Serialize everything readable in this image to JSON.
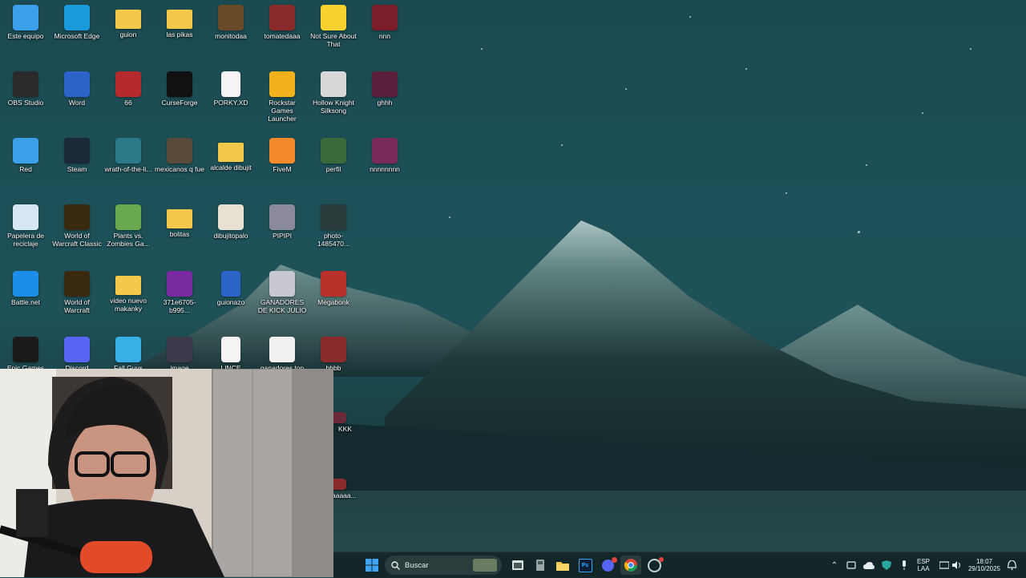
{
  "desktop": {
    "icons": [
      {
        "label": "Este equipo",
        "icon": "monitor-icon",
        "color": "#3aa0e8"
      },
      {
        "label": "Microsoft Edge",
        "icon": "edge-icon",
        "color": "#1b9ad9"
      },
      {
        "label": "guion",
        "icon": "folder-icon",
        "color": "#f3c94b"
      },
      {
        "label": "las pikas",
        "icon": "folder-icon",
        "color": "#f3c94b"
      },
      {
        "label": "monitodaa",
        "icon": "image-thumbnail-icon",
        "color": "#6b4a2a"
      },
      {
        "label": "tomatedaaa",
        "icon": "image-thumbnail-icon",
        "color": "#8a2a2a"
      },
      {
        "label": "Not Sure About That",
        "icon": "rubber-duck-icon",
        "color": "#f5d230"
      },
      {
        "label": "nnn",
        "icon": "video-thumbnail-icon",
        "color": "#7a1f2a"
      },
      {
        "label": "OBS Studio",
        "icon": "obs-icon",
        "color": "#2b2b2b"
      },
      {
        "label": "Word",
        "icon": "word-icon",
        "color": "#2b63c7"
      },
      {
        "label": "66",
        "icon": "image-thumbnail-icon",
        "color": "#b52a2a"
      },
      {
        "label": "CurseForge",
        "icon": "curseforge-icon",
        "color": "#111111"
      },
      {
        "label": "PORKY.XD",
        "icon": "video-file-icon",
        "color": "#f4f4f4"
      },
      {
        "label": "Rockstar Games Launcher",
        "icon": "rockstar-icon",
        "color": "#f2b21c"
      },
      {
        "label": "Hollow Knight Silksong",
        "icon": "hollow-knight-icon",
        "color": "#d8d8d8"
      },
      {
        "label": "ghhh",
        "icon": "video-thumbnail-icon",
        "color": "#5a1f3a"
      },
      {
        "label": "Red",
        "icon": "network-icon",
        "color": "#3aa0e8"
      },
      {
        "label": "Steam",
        "icon": "steam-icon",
        "color": "#1b2838"
      },
      {
        "label": "wrath-of-the-li...",
        "icon": "image-thumbnail-icon",
        "color": "#2a7a8a"
      },
      {
        "label": "mexicanos q fue",
        "icon": "image-thumbnail-icon",
        "color": "#5a4a3a"
      },
      {
        "label": "alcalde dibujit",
        "icon": "folder-icon",
        "color": "#f3c94b"
      },
      {
        "label": "FiveM",
        "icon": "fivem-icon",
        "color": "#f28a2a"
      },
      {
        "label": "perfil",
        "icon": "image-thumbnail-icon",
        "color": "#3a6a3a"
      },
      {
        "label": "nnnnnnnn",
        "icon": "video-thumbnail-icon",
        "color": "#7a2a5a"
      },
      {
        "label": "Papelera de reciclaje",
        "icon": "recycle-bin-icon",
        "color": "#d6e6f2"
      },
      {
        "label": "World of Warcraft Classic",
        "icon": "wow-icon",
        "color": "#3a2a10"
      },
      {
        "label": "Plants vs. Zombies Ga...",
        "icon": "pvz-icon",
        "color": "#6aa84f"
      },
      {
        "label": "bolitas",
        "icon": "folder-icon",
        "color": "#f3c94b"
      },
      {
        "label": "dibujitopalo",
        "icon": "image-thumbnail-icon",
        "color": "#e8e0d0"
      },
      {
        "label": "PIPIPI",
        "icon": "image-thumbnail-icon",
        "color": "#8a8a9a"
      },
      {
        "label": "photo-1485470...",
        "icon": "image-thumbnail-icon",
        "color": "#2a3a3a"
      },
      {
        "label": "",
        "icon": "",
        "color": ""
      },
      {
        "label": "Battle.net",
        "icon": "battlenet-icon",
        "color": "#1c8ee8"
      },
      {
        "label": "World of Warcraft",
        "icon": "wow-icon",
        "color": "#3a2a10"
      },
      {
        "label": "video nuevo makanky",
        "icon": "folder-icon",
        "color": "#f3c94b"
      },
      {
        "label": "371e6705-b995...",
        "icon": "image-thumbnail-icon",
        "color": "#7a2aa0"
      },
      {
        "label": "guionazo",
        "icon": "word-doc-icon",
        "color": "#2b63c7"
      },
      {
        "label": "GANADORES DE KICK JULIO",
        "icon": "image-thumbnail-icon",
        "color": "#c8c8d0"
      },
      {
        "label": "Megabonk",
        "icon": "megabonk-icon",
        "color": "#b8302a"
      },
      {
        "label": "",
        "icon": "",
        "color": ""
      },
      {
        "label": "Epic Games",
        "icon": "epic-games-icon",
        "color": "#1a1a1a"
      },
      {
        "label": "Discord",
        "icon": "discord-icon",
        "color": "#5865f2"
      },
      {
        "label": "Fall Guys",
        "icon": "fall-guys-icon",
        "color": "#3ab0e8"
      },
      {
        "label": "image",
        "icon": "image-thumbnail-icon",
        "color": "#3a3a4a"
      },
      {
        "label": "LINCE",
        "icon": "video-file-icon",
        "color": "#f4f4f4"
      },
      {
        "label": "ganadores top",
        "icon": "image-thumbnail-icon",
        "color": "#f0f0f0"
      },
      {
        "label": "bbbb",
        "icon": "video-thumbnail-icon",
        "color": "#8a2a2a"
      },
      {
        "label": "",
        "icon": "",
        "color": ""
      }
    ],
    "partial_icons": [
      {
        "label": "KKK",
        "icon": "video-thumbnail-icon"
      },
      {
        "label": "aaaaa...",
        "icon": "video-thumbnail-icon"
      }
    ]
  },
  "taskbar": {
    "search_placeholder": "Buscar",
    "apps": [
      "start-icon",
      "task-view-icon",
      "app-icon",
      "file-explorer-icon",
      "photoshop-icon",
      "discord-icon",
      "chrome-icon",
      "app-icon"
    ],
    "photoshop_label": "Ps",
    "language_line1": "ESP",
    "language_line2": "LAA",
    "time": "18:07",
    "date": "29/10/2025"
  }
}
